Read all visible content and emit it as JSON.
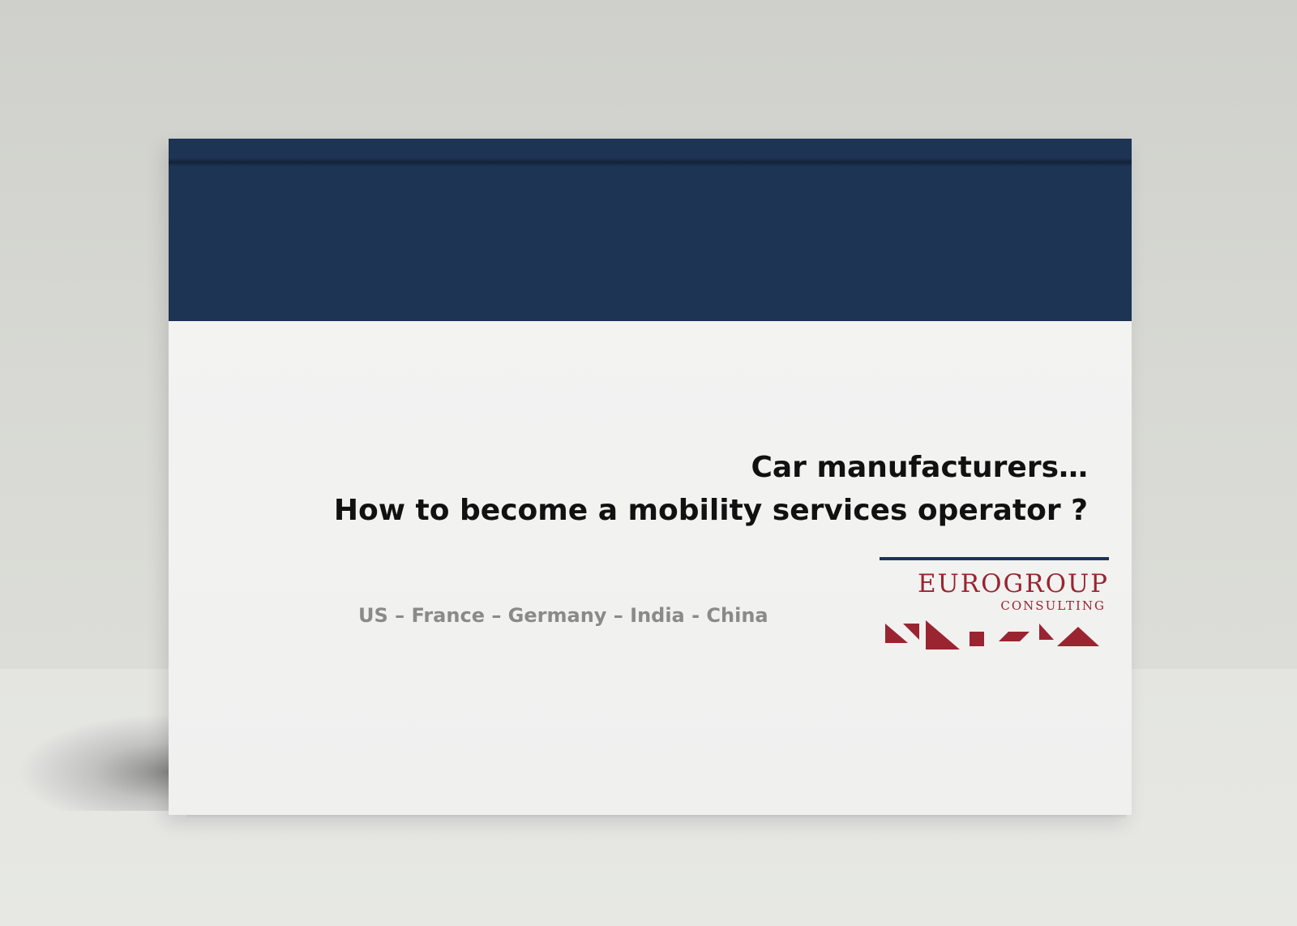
{
  "cover": {
    "title_line1": "Car manufacturers…",
    "title_line2": "How to become a mobility services operator ?",
    "countries": "US – France – Germany – India - China"
  },
  "logo": {
    "name": "EUROGROUP",
    "subtitle": "CONSULTING"
  },
  "colors": {
    "navy_band": "#1d3455",
    "logo_red": "#9a2430",
    "title_text": "#111111",
    "countries_text": "#8a8a8a"
  }
}
